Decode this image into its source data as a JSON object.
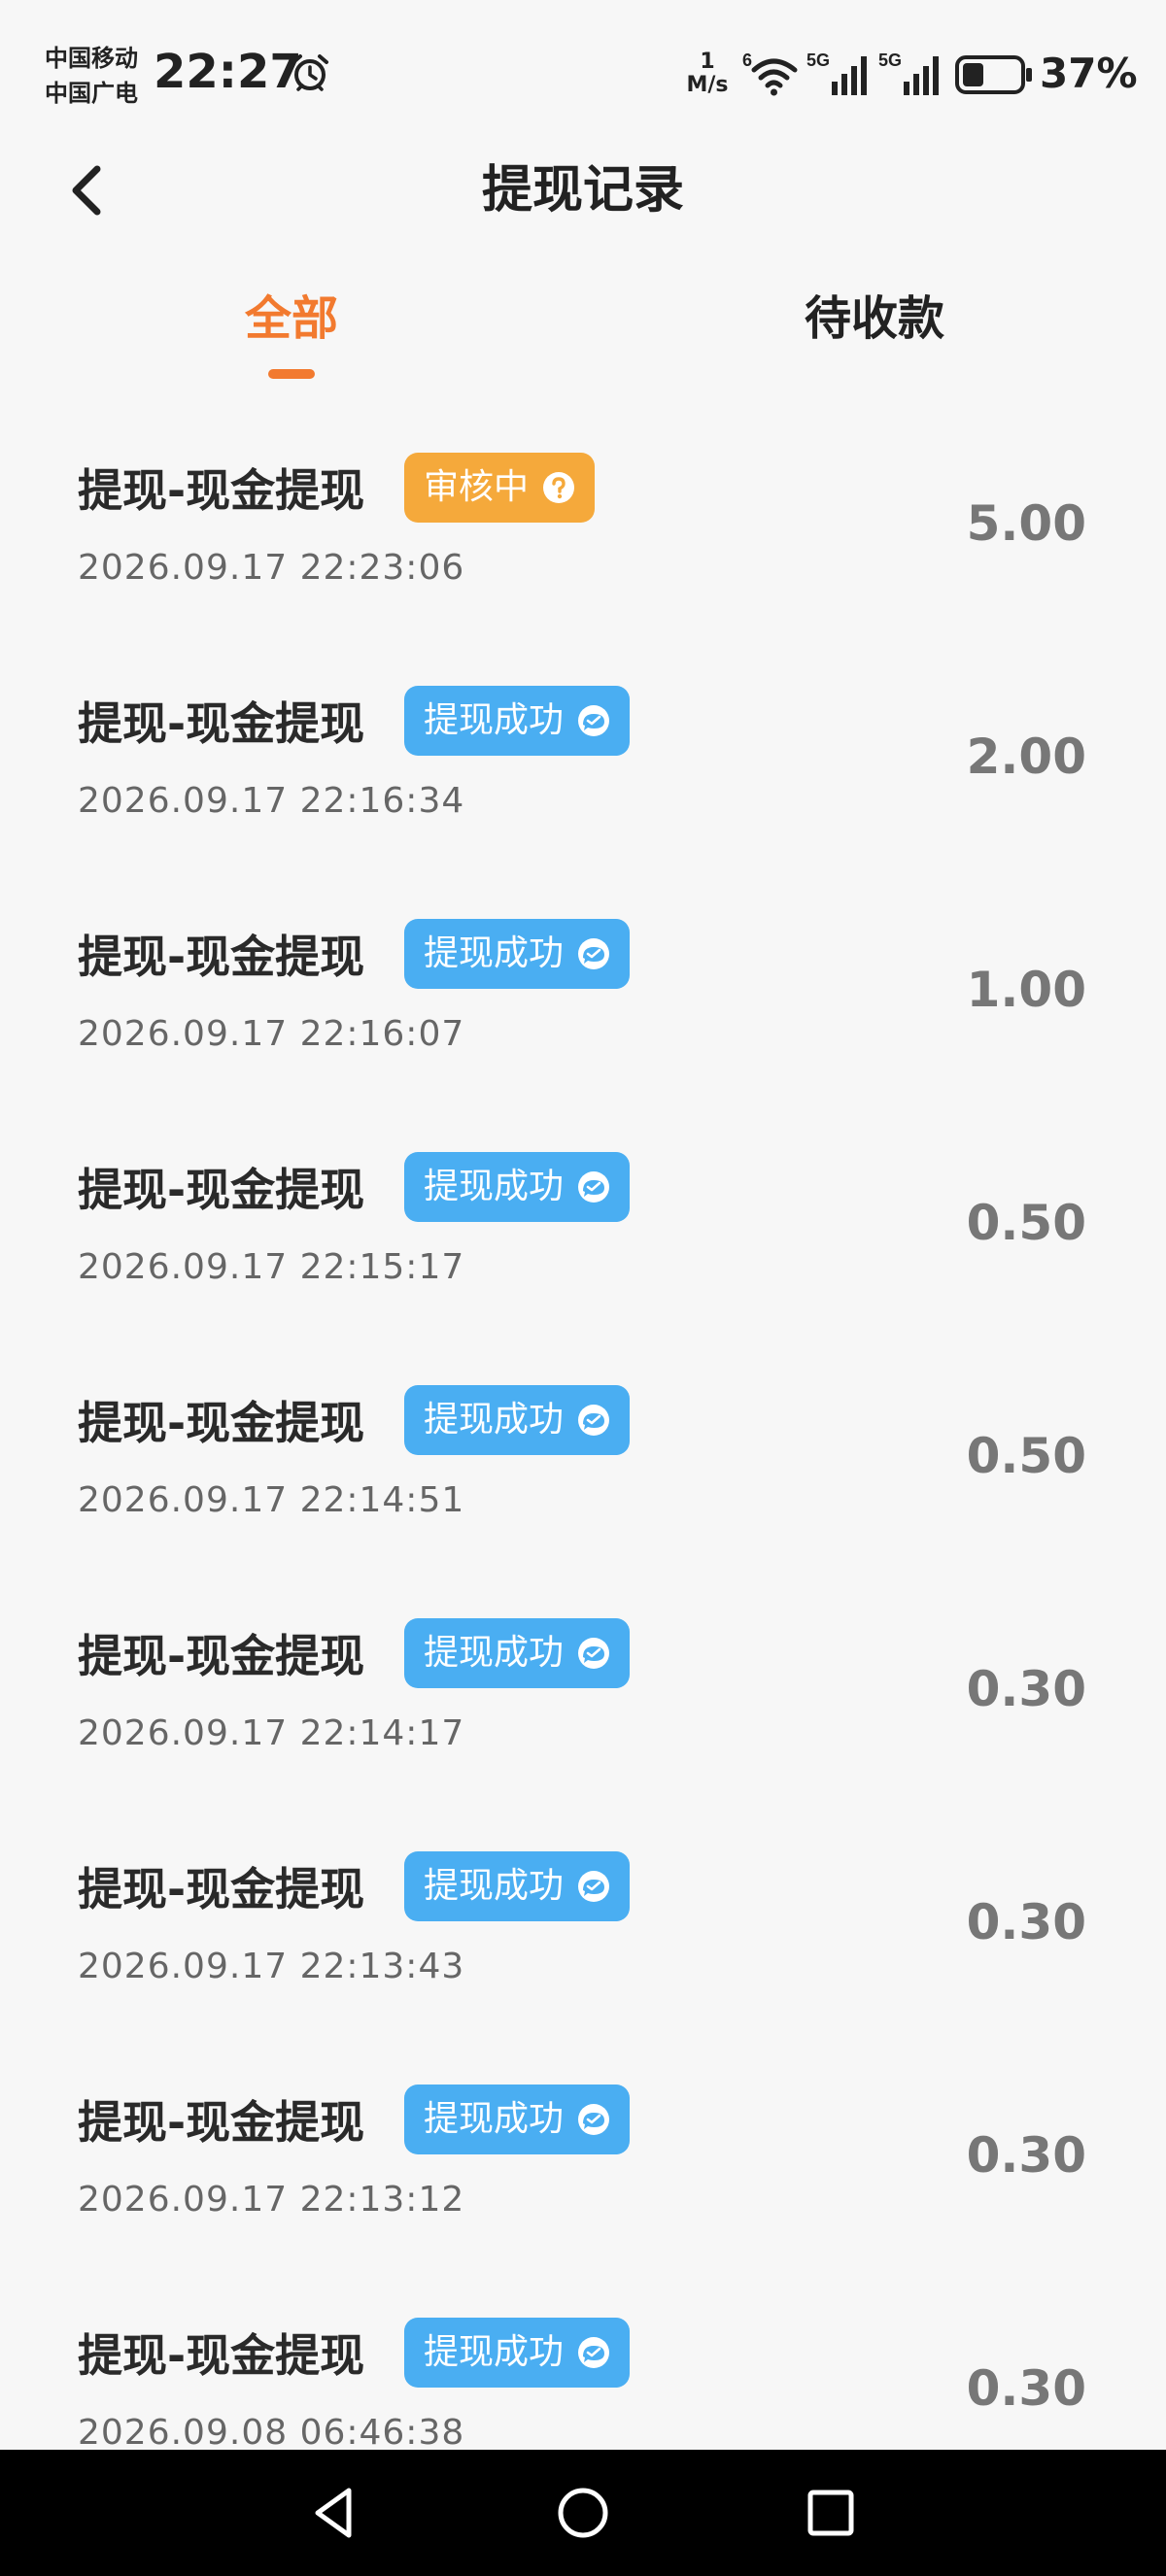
{
  "status_bar": {
    "carrier_1": "中国移动",
    "carrier_2": "中国广电",
    "time": "22:27",
    "net_speed_value": "1",
    "net_speed_unit": "M/s",
    "wifi_label": "6",
    "signal_1_label": "5G",
    "signal_2_label": "5G",
    "battery_percent": "37%",
    "battery_level": 0.37
  },
  "header": {
    "title": "提现记录"
  },
  "tabs": [
    {
      "label": "全部",
      "active": true
    },
    {
      "label": "待收款",
      "active": false
    }
  ],
  "colors": {
    "accent": "#f27a2f",
    "pending_badge": "#f5a93b",
    "success_badge": "#4aaef2",
    "background": "#f7f7f7"
  },
  "records": [
    {
      "title": "提现-现金提现",
      "status": "审核中",
      "status_icon": "help-circle-icon",
      "time": "2026.09.17 22:23:06",
      "amount": "5.00"
    },
    {
      "title": "提现-现金提现",
      "status": "提现成功",
      "status_icon": "wechat-icon",
      "time": "2026.09.17 22:16:34",
      "amount": "2.00"
    },
    {
      "title": "提现-现金提现",
      "status": "提现成功",
      "status_icon": "wechat-icon",
      "time": "2026.09.17 22:16:07",
      "amount": "1.00"
    },
    {
      "title": "提现-现金提现",
      "status": "提现成功",
      "status_icon": "wechat-icon",
      "time": "2026.09.17 22:15:17",
      "amount": "0.50"
    },
    {
      "title": "提现-现金提现",
      "status": "提现成功",
      "status_icon": "wechat-icon",
      "time": "2026.09.17 22:14:51",
      "amount": "0.50"
    },
    {
      "title": "提现-现金提现",
      "status": "提现成功",
      "status_icon": "wechat-icon",
      "time": "2026.09.17 22:14:17",
      "amount": "0.30"
    },
    {
      "title": "提现-现金提现",
      "status": "提现成功",
      "status_icon": "wechat-icon",
      "time": "2026.09.17 22:13:43",
      "amount": "0.30"
    },
    {
      "title": "提现-现金提现",
      "status": "提现成功",
      "status_icon": "wechat-icon",
      "time": "2026.09.17 22:13:12",
      "amount": "0.30"
    },
    {
      "title": "提现-现金提现",
      "status": "提现成功",
      "status_icon": "wechat-icon",
      "time": "2026.09.08 06:46:38",
      "amount": "0.30"
    }
  ],
  "nav": {
    "back_icon": "triangle-back-icon",
    "home_icon": "circle-home-icon",
    "recent_icon": "square-recents-icon"
  }
}
